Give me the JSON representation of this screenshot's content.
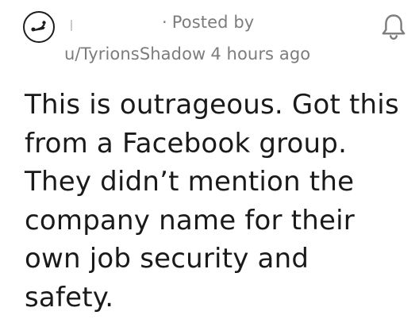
{
  "post": {
    "posted_by_prefix": "Posted by",
    "author": "u/TyrionsShadow",
    "timestamp": "4 hours ago",
    "title": "This is outrageous. Got this from a Facebook group. They didn’t mention the company name for their own job security and safety."
  },
  "icons": {
    "subreddit_avatar": "subreddit-avatar-icon",
    "notification": "bell-icon"
  },
  "colors": {
    "meta_text": "#7c7c7c",
    "title_text": "#1a1a1a"
  }
}
